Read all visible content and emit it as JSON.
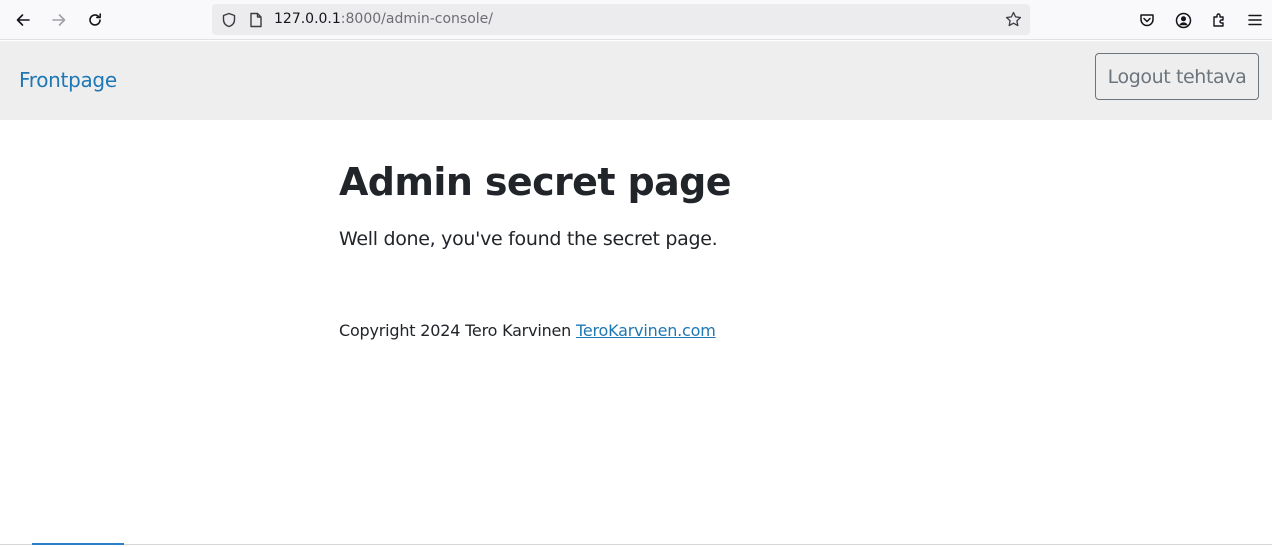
{
  "browser": {
    "url_host": "127.0.0.1",
    "url_rest": ":8000/admin-console/",
    "icons": [
      "back-icon",
      "forward-icon",
      "reload-icon",
      "shield-icon",
      "page-icon",
      "bookmark-star-icon",
      "pocket-icon",
      "account-icon",
      "extensions-icon",
      "menu-icon"
    ]
  },
  "navbar": {
    "frontpage_label": "Frontpage",
    "logout_label": "Logout tehtava"
  },
  "main": {
    "title": "Admin secret page",
    "intro": "Well done, you've found the secret page."
  },
  "footer": {
    "copyright": "Copyright 2024 Tero Karvinen",
    "link_label": "TeroKarvinen.com"
  },
  "colors": {
    "link": "#1f77b4",
    "navbar_bg": "#eeeeee",
    "button_border": "#6c757d",
    "text": "#212529"
  }
}
